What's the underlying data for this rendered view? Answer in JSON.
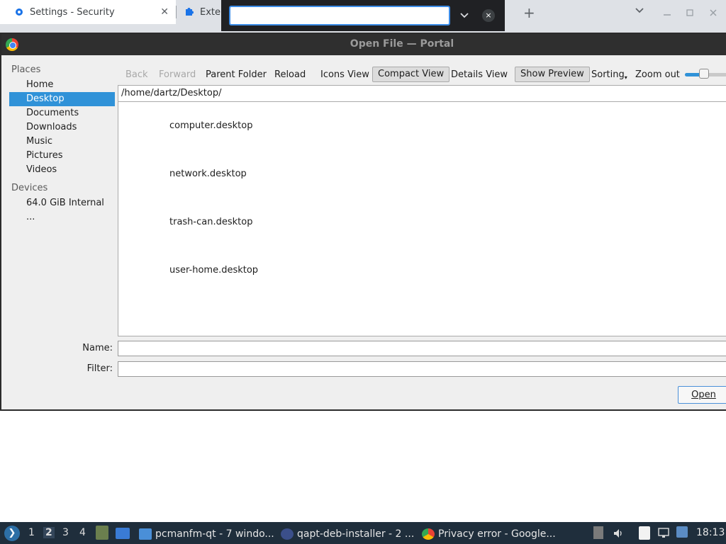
{
  "browser": {
    "tabs": [
      {
        "label": "Settings - Security",
        "icon": "gear-icon"
      },
      {
        "label": "Exte",
        "icon": "puzzle-icon"
      }
    ],
    "close_glyph": "✕",
    "new_tab_glyph": "+",
    "find_close_glyph": "×"
  },
  "dialog": {
    "title": "Open File — Portal",
    "places_header": "Places",
    "places": [
      "Home",
      "Desktop",
      "Documents",
      "Downloads",
      "Music",
      "Pictures",
      "Videos"
    ],
    "selected_place": "Desktop",
    "devices_header": "Devices",
    "devices": [
      "64.0 GiB Internal ..."
    ],
    "toolbar": {
      "back": "Back",
      "forward": "Forward",
      "parent": "Parent Folder",
      "reload": "Reload",
      "icons_view": "Icons View",
      "compact_view": "Compact View",
      "details_view": "Details View",
      "show_preview": "Show Preview",
      "sorting": "Sorting",
      "zoom_out": "Zoom out"
    },
    "zoom_level": 0.47,
    "path": "/home/dartz/Desktop/",
    "files": [
      "computer.desktop",
      "network.desktop",
      "trash-can.desktop",
      "user-home.desktop"
    ],
    "name_label": "Name:",
    "filter_label": "Filter:",
    "name_value": "",
    "filter_value": "",
    "open_button": "Open",
    "accent_color": "#3092d8"
  },
  "taskbar": {
    "workspaces": [
      "1",
      "2",
      "3",
      "4"
    ],
    "active_workspace": "2",
    "tasks": [
      {
        "label": "pcmanfm-qt - 7 windo...",
        "icon": "folder-icon"
      },
      {
        "label": "qapt-deb-installer - 2 ...",
        "icon": "package-icon"
      },
      {
        "label": "Privacy error - Google...",
        "icon": "chrome-icon"
      }
    ],
    "clock": "18:13"
  }
}
